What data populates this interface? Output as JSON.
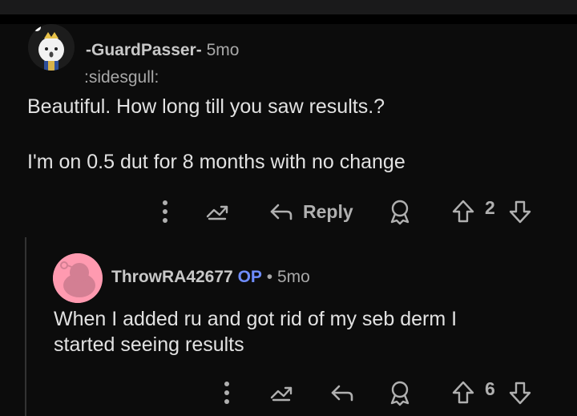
{
  "comments": [
    {
      "author": "-GuardPasser-",
      "age": "5mo",
      "flair": ":sidesgull:",
      "text_line1": "Beautiful. How long till you saw results.?",
      "text_line2": "I'm on 0.5 dut for 8 months with no change",
      "reply_label": "Reply",
      "votes": "2"
    },
    {
      "author": "ThrowRA42677",
      "op_badge": "OP",
      "separator": "•",
      "age": "5mo",
      "text_line1": "When I added ru and got rid of my seb derm I",
      "text_line2": "started seeing results",
      "votes": "6"
    }
  ],
  "colors": {
    "background": "#0c0c0c",
    "op_badge": "#6f8dff",
    "avatar2_bg": "#ff9ab0"
  },
  "icons": [
    "more-icon",
    "share-icon",
    "reply-icon",
    "award-icon",
    "upvote-icon",
    "downvote-icon"
  ]
}
